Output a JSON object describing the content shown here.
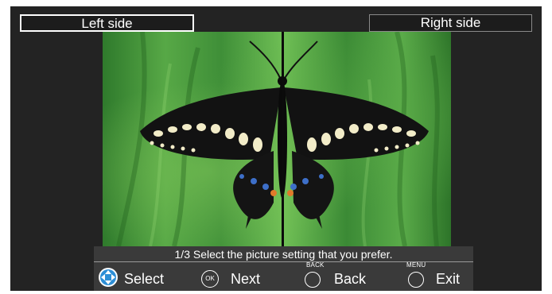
{
  "screen": {
    "left_side_label": "Left side",
    "right_side_label": "Right side"
  },
  "instruction": "1/3 Select the picture setting that you prefer.",
  "controls": [
    {
      "icon": "dpad-icon",
      "label": "Select"
    },
    {
      "icon": "ok-button-icon",
      "badge": "OK",
      "label": "Next"
    },
    {
      "icon": "back-button-icon",
      "badge": "BACK",
      "label": "Back"
    },
    {
      "icon": "menu-button-icon",
      "badge": "MENU",
      "label": "Exit"
    }
  ],
  "colors": {
    "background": "#232323",
    "bar": "#3a3a3a",
    "text": "#ffffff",
    "dpad": "#2e8fd6"
  }
}
